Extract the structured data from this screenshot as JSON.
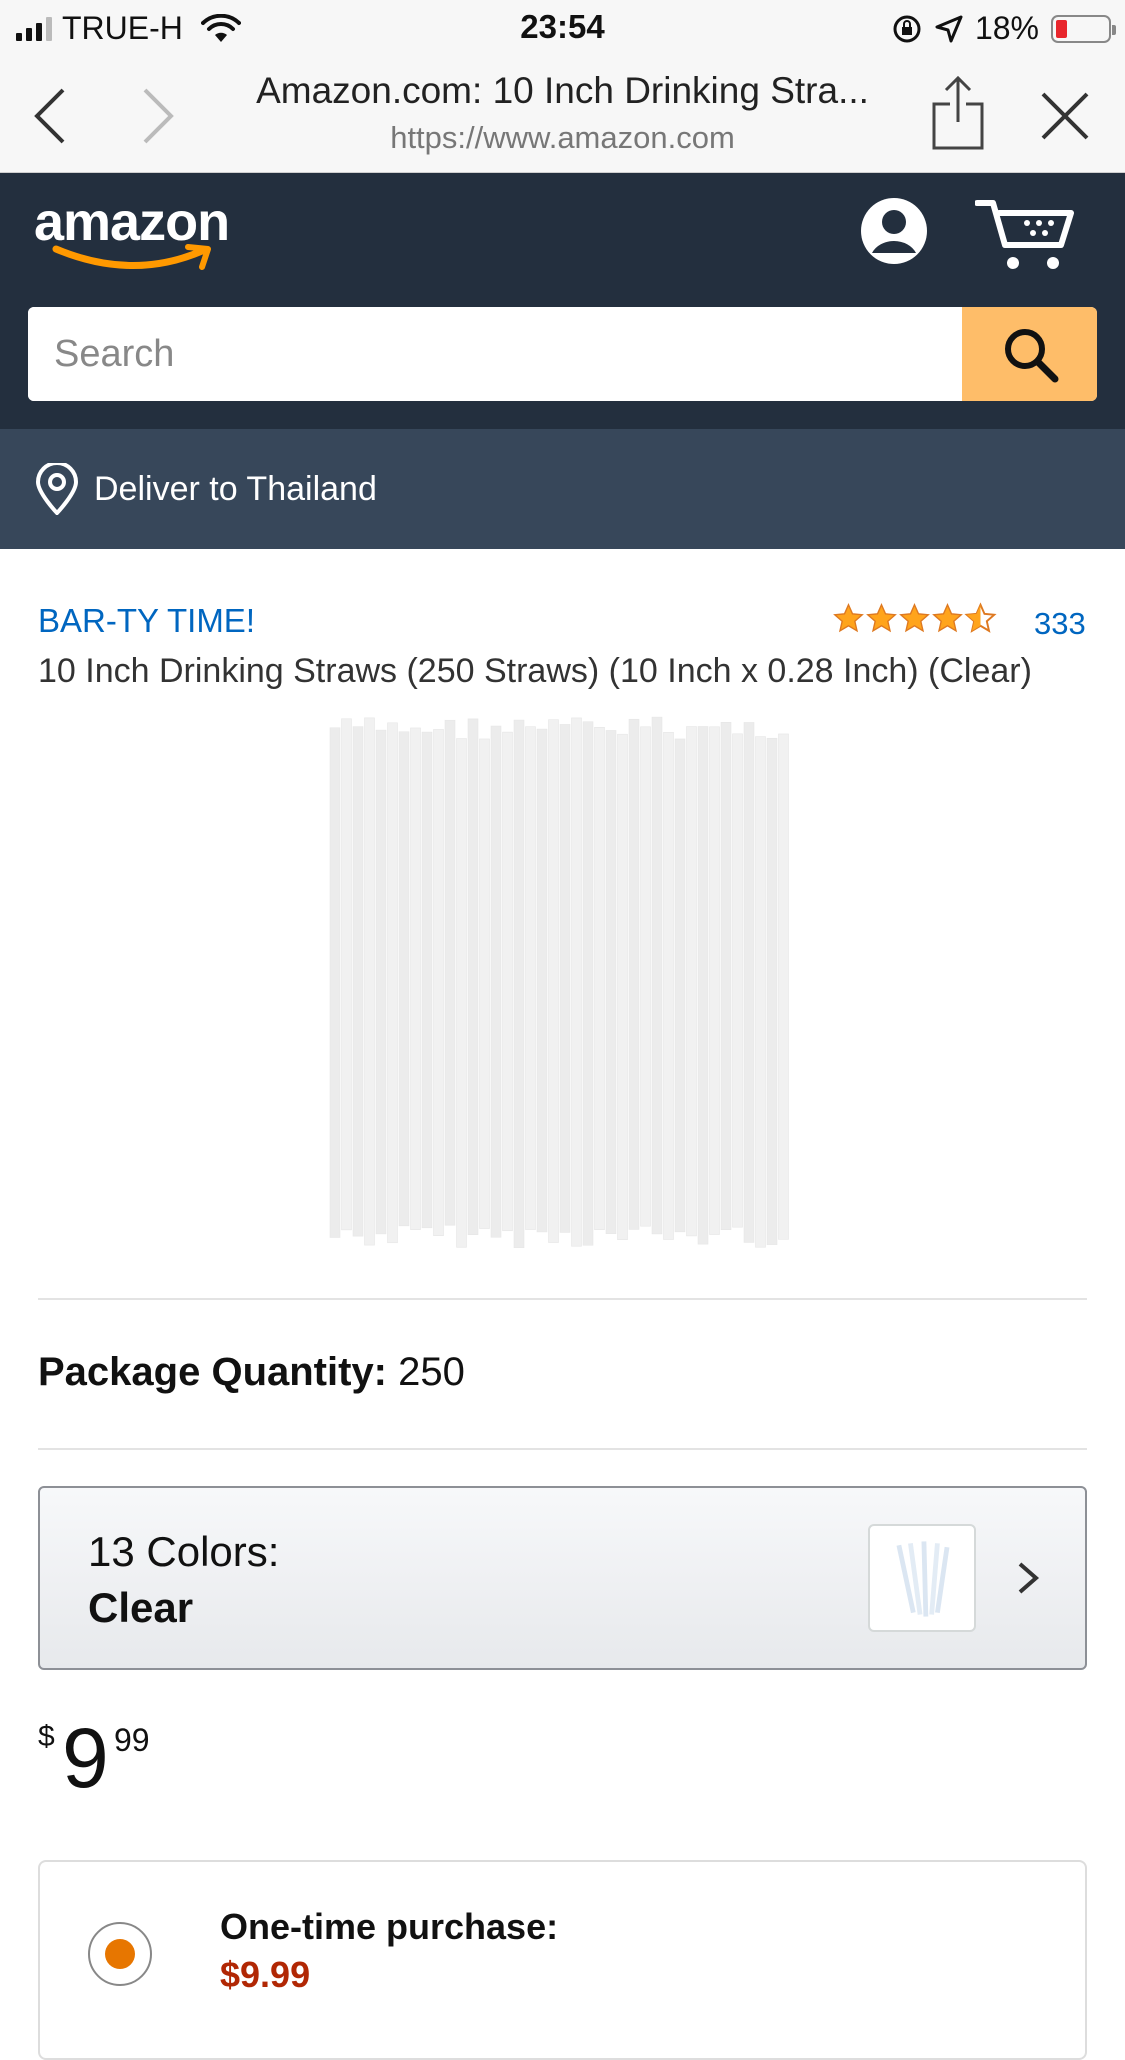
{
  "status_bar": {
    "carrier": "TRUE-H",
    "time": "23:54",
    "battery": "18%",
    "battery_level": 0.18
  },
  "browser": {
    "title": "Amazon.com: 10 Inch Drinking Stra...",
    "url": "https://www.amazon.com"
  },
  "header": {
    "logo": "amazon",
    "search_placeholder": "Search"
  },
  "delivery": {
    "text": "Deliver to Thailand"
  },
  "product": {
    "brand": "BAR-TY TIME!",
    "rating": 4.5,
    "rating_count": "333",
    "title": "10 Inch Drinking Straws (250 Straws) (10 Inch x 0.28 Inch) (Clear)",
    "package_quantity_label": "Package Quantity:",
    "package_quantity_value": "250",
    "colors_label": "13 Colors:",
    "colors_value": "Clear",
    "price": {
      "currency": "$",
      "whole": "9",
      "fraction": "99"
    },
    "purchase_option_label": "One-time purchase:",
    "purchase_option_price": "$9.99"
  },
  "colors": {
    "header_bg": "#232f3e",
    "deliver_bg": "#37475a",
    "search_button": "#febd69",
    "link_blue": "#0066c0",
    "star": "#ffa41c",
    "price_red": "#b12704",
    "radio_orange": "#e77600"
  }
}
